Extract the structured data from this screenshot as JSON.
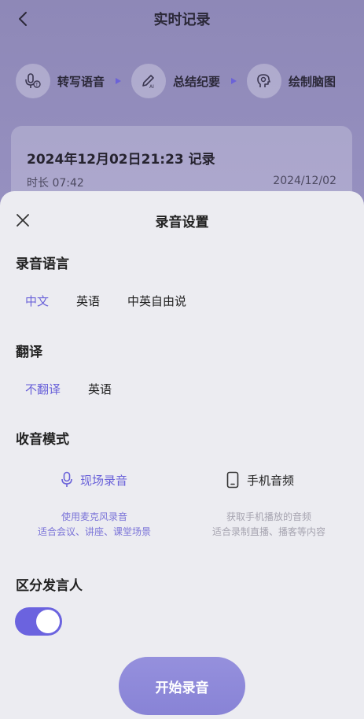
{
  "header": {
    "title": "实时记录",
    "back_icon": "chevron-left-icon"
  },
  "steps": [
    {
      "icon": "mic-transcribe-icon",
      "label": "转写语音"
    },
    {
      "icon": "ai-pen-icon",
      "label": "总结纪要"
    },
    {
      "icon": "brain-head-icon",
      "label": "绘制脑图"
    }
  ],
  "record": {
    "title": "2024年12月02日21:23 记录",
    "duration": "时长 07:42",
    "date": "2024/12/02"
  },
  "sheet": {
    "title": "录音设置",
    "close_icon": "close-icon",
    "language": {
      "title": "录音语言",
      "options": [
        "中文",
        "英语",
        "中英自由说"
      ],
      "selected": "中文"
    },
    "translate": {
      "title": "翻译",
      "options": [
        "不翻译",
        "英语"
      ],
      "selected": "不翻译"
    },
    "mode": {
      "title": "收音模式",
      "options": [
        {
          "icon": "microphone-icon",
          "label": "现场录音",
          "desc1": "使用麦克风录音",
          "desc2": "适合会议、讲座、课堂场景",
          "selected": true
        },
        {
          "icon": "phone-icon",
          "label": "手机音频",
          "desc1": "获取手机播放的音频",
          "desc2": "适合录制直播、播客等内容",
          "selected": false
        }
      ]
    },
    "speaker": {
      "title": "区分发言人",
      "enabled": true
    },
    "start_label": "开始录音"
  },
  "colors": {
    "accent": "#6a62d9",
    "sheet_bg": "#ececf1",
    "toggle_on": "#6b63df"
  }
}
